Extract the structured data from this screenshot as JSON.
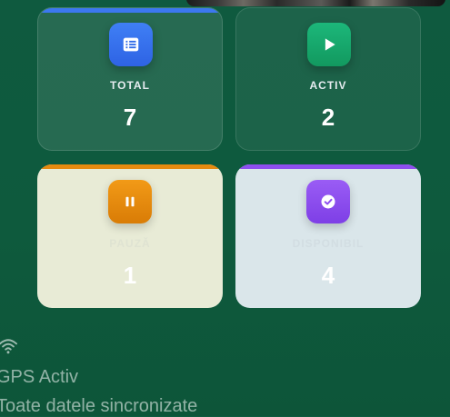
{
  "stats": {
    "total": {
      "label": "TOTAL",
      "value": "7",
      "color": "#2f6ae8",
      "icon": "list-icon"
    },
    "activ": {
      "label": "ACTIV",
      "value": "2",
      "color": "#15a46c",
      "icon": "play-icon"
    },
    "pauza": {
      "label": "PAUZĂ",
      "value": "1",
      "color": "#e58a0f",
      "icon": "pause-icon"
    },
    "disponibil": {
      "label": "DISPONIBIL",
      "value": "4",
      "color": "#8e4ff0",
      "icon": "check-circle-icon"
    }
  },
  "status": {
    "icon": "wifi-icon",
    "gps": "GPS Activ",
    "sync": "Toate datele sincronizate"
  }
}
